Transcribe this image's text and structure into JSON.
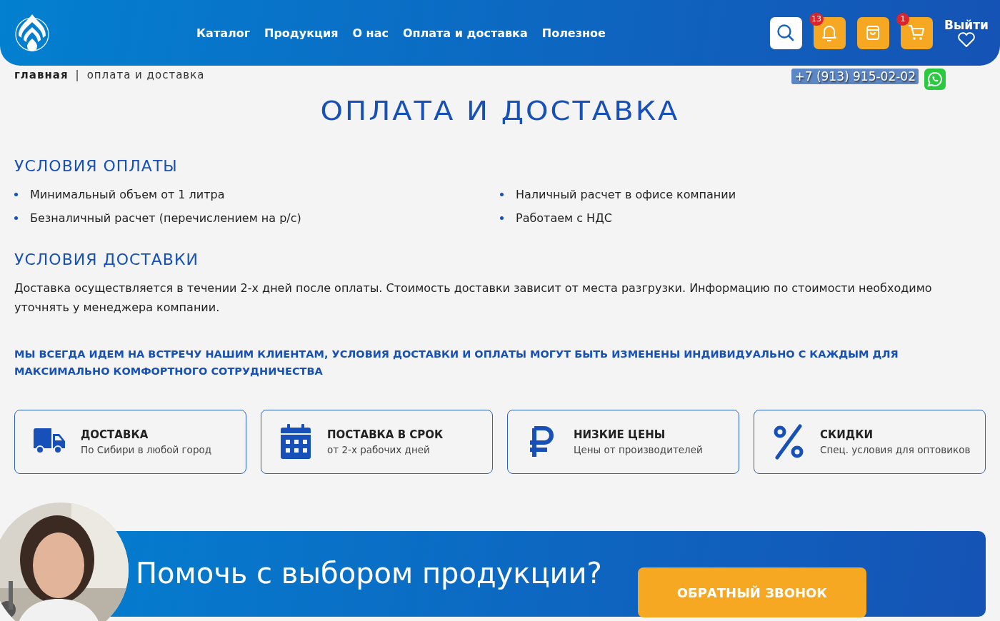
{
  "header": {
    "nav": [
      "Каталог",
      "Продукция",
      "О нас",
      "Оплата и доставка",
      "Полезное"
    ],
    "icons": [
      {
        "kind": "search"
      },
      {
        "kind": "bell",
        "badge": "13"
      },
      {
        "kind": "bag"
      },
      {
        "kind": "cart",
        "badge": "1"
      }
    ],
    "logout": "Выйти"
  },
  "breadcrumb": [
    "главная",
    "|",
    "оплата и доставка"
  ],
  "phone": "+7 (913) 915-02-02",
  "title": "ОПЛАТА И ДОСТАВКА",
  "payment": {
    "heading": "УСЛОВИЯ ОПЛАТЫ",
    "items": [
      "Минимальный объем от 1 литра",
      "Наличный расчет в офисе компании",
      "Безналичный расчет (перечислением на р/с)",
      "Работаем с НДС"
    ]
  },
  "delivery": {
    "heading": "УСЛОВИЯ ДОСТАВКИ",
    "text": "Доставка осуществляется в течении 2-х дней после оплаты. Стоимость доставки зависит от места разгрузки. Информацию по стоимости необходимо уточнять у менеджера компании."
  },
  "notice": "МЫ ВСЕГДА ИДЕМ НА ВСТРЕЧУ НАШИМ КЛИЕНТАМ, УСЛОВИЯ ДОСТАВКИ И ОПЛАТЫ МОГУТ БЫТЬ ИЗМЕНЕНЫ ИНДИВИДУАЛЬНО С КАЖДЫМ ДЛЯ МАКСИМАЛЬНО КОМФОРТНОГО СОТРУДНИЧЕСТВА",
  "features": [
    {
      "kind": "truck",
      "title": "ДОСТАВКА",
      "text": "По Сибири в любой город"
    },
    {
      "kind": "calendar",
      "title": "ПОСТАВКА В СРОК",
      "text": "от 2-х рабочих дней"
    },
    {
      "kind": "ruble",
      "title": "НИЗКИЕ ЦЕНЫ",
      "text": "Цены от производителей"
    },
    {
      "kind": "percent",
      "title": "СКИДКИ",
      "text": "Спец. условия для оптовиков"
    }
  ],
  "banner": {
    "heading": "Помочь с выбором продукции?",
    "button": "ОБРАТНЫЙ ЗВОНОК"
  }
}
